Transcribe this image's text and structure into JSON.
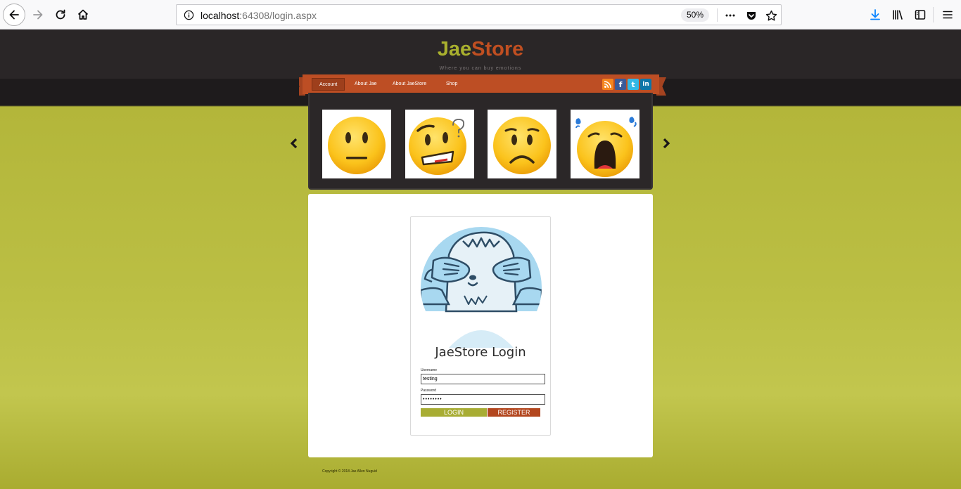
{
  "browser": {
    "url_host": "localhost",
    "url_rest": ":64308/login.aspx",
    "zoom": "50%"
  },
  "site": {
    "logo_part1": "Jae",
    "logo_part2": "Store",
    "tagline": "Where you can buy emotions"
  },
  "nav": {
    "items": [
      {
        "label": "Account"
      },
      {
        "label": "About Jae"
      },
      {
        "label": "About JaeStore"
      },
      {
        "label": "Shop"
      }
    ],
    "social": {
      "rss": "",
      "facebook": "f",
      "twitter": "t",
      "linkedin": "in"
    }
  },
  "carousel": {
    "prev": "‹",
    "next": "›",
    "emojis": [
      "neutral-face",
      "confused-face",
      "sad-face",
      "crying-face"
    ]
  },
  "login": {
    "title": "JaeStore Login",
    "username_label": "Username",
    "username_value": "testing",
    "password_label": "Password",
    "password_value": "••••••••",
    "login_button": "LOGIN",
    "register_button": "REGISTER"
  },
  "footer": {
    "copyright": "Copyright © 2018 Jae Allen Nuguid"
  },
  "colors": {
    "accent_green": "#a8ad34",
    "accent_orange": "#bd4e24",
    "header_dark": "#2a2627"
  }
}
